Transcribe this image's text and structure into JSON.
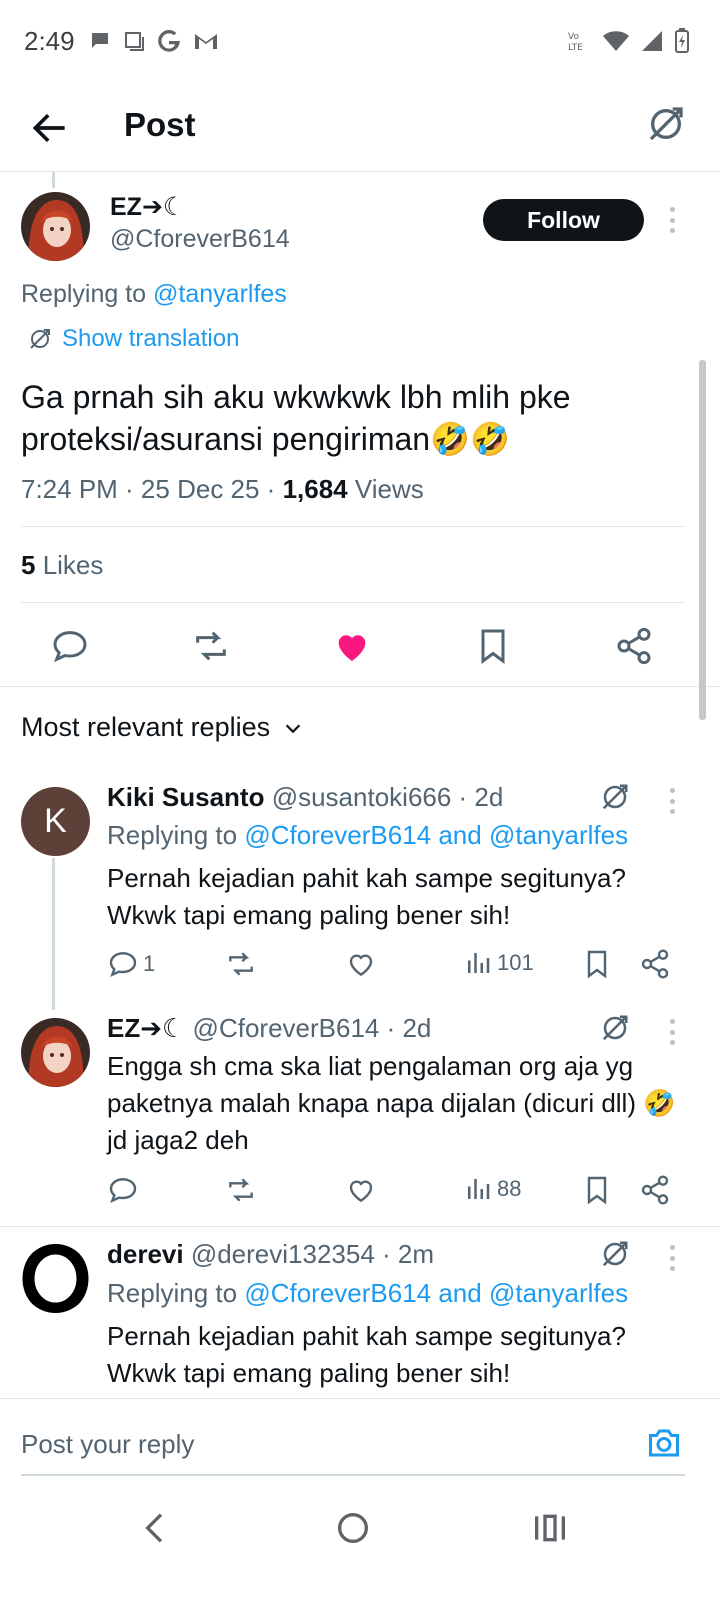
{
  "status_bar": {
    "time": "2:49"
  },
  "header": {
    "title": "Post"
  },
  "main_post": {
    "display_name": "EZ➔☾",
    "handle": "@CforeverB614",
    "follow_label": "Follow",
    "replying_prefix": "Replying to",
    "replying_to": "@tanyarlfes",
    "show_translation": "Show translation",
    "text": "Ga prnah sih aku wkwkwk lbh mlih pke proteksi/asuransi pengiriman🤣🤣",
    "time_date": "7:24 PM · 25 Dec 25 · ",
    "views_count": "1,684",
    "views_label": " Views",
    "likes_count": "5",
    "likes_label": " Likes",
    "liked": true,
    "like_color": "#f91880"
  },
  "sort": {
    "label": "Most relevant replies"
  },
  "replies": [
    {
      "avatar_letter": "K",
      "name": "Kiki Susanto",
      "handle_time": " @susantoki666 · 2d",
      "replying_prefix": "Replying to ",
      "replying_to": "@CforeverB614 and @tanyarlfes",
      "text": "Pernah kejadian pahit kah sampe segitunya? Wkwk tapi emang paling bener sih!",
      "reply_count": "1",
      "views": "101"
    },
    {
      "name": "EZ➔☾",
      "handle_time": " @CforeverB614 · 2d",
      "text": "Engga sh cma ska liat pengalaman org aja yg paketnya malah knapa napa dijalan (dicuri dll) 🤣 jd jaga2 deh",
      "views": "88"
    },
    {
      "avatar_letter": "O",
      "name": "derevi",
      "handle_time": " @derevi132354 · 2m",
      "replying_prefix": "Replying to ",
      "replying_to": "@CforeverB614 and @tanyarlfes",
      "text": "Pernah kejadian pahit kah sampe segitunya? Wkwk tapi emang paling bener sih!"
    }
  ],
  "composer": {
    "placeholder": "Post your reply"
  },
  "colors": {
    "accent": "#1d9bf0",
    "like": "#f91880",
    "text": "#0f1419",
    "secondary": "#536471"
  }
}
